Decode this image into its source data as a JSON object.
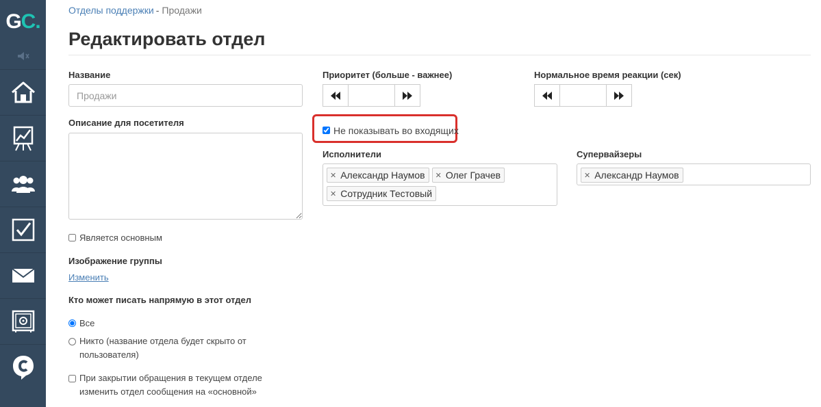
{
  "sidebar": {
    "logo": {
      "g": "G",
      "c": "C",
      "dot": "."
    },
    "icons": [
      "mute-icon",
      "home-icon",
      "chart-icon",
      "users-icon",
      "tasks-icon",
      "mail-icon",
      "safe-icon",
      "chat-logo-icon"
    ]
  },
  "breadcrumb": {
    "parent": "Отделы поддержки",
    "separator": "-",
    "current": "Продажи"
  },
  "page": {
    "title": "Редактировать отдел"
  },
  "form": {
    "name_label": "Название",
    "name_value": "",
    "name_placeholder": "Продажи",
    "description_label": "Описание для посетителя",
    "is_main_label": "Является основным",
    "is_main_checked": false,
    "group_image_label": "Изображение группы",
    "group_image_change": "Изменить",
    "who_can_write_label": "Кто может писать напрямую в этот отдел",
    "radio_all": "Все",
    "radio_nobody_line1": "Никто (название отдела будет скрыто от",
    "radio_nobody_line2": "пользователя)",
    "change_on_close_line1": "При закрытии обращения в текущем отделе",
    "change_on_close_line2": "изменить отдел сообщения на «основной»",
    "priority_label": "Приоритет (больше - важнее)",
    "priority_value": "",
    "reaction_label": "Нормальное время реакции (сек)",
    "reaction_value": "",
    "hide_incoming_label": "Не показывать во входящих",
    "hide_incoming_checked": true,
    "executors_label": "Исполнители",
    "executors": [
      "Александр Наумов",
      "Олег Грачев",
      "Сотрудник Тестовый"
    ],
    "supervisors_label": "Супервайзеры",
    "supervisors": [
      "Александр Наумов"
    ]
  },
  "colors": {
    "sidebar": "#34495e",
    "accent": "#1ec3b3",
    "link": "#4a7fb5",
    "highlight": "#d9302c"
  }
}
